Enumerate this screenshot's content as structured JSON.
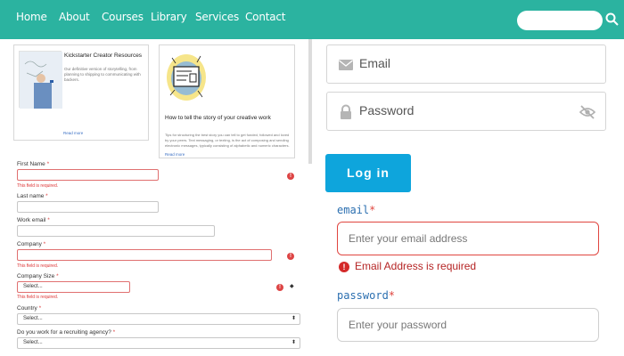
{
  "nav": {
    "items": [
      "Home",
      "About",
      "Courses",
      "Library",
      "Services",
      "Contact"
    ],
    "search_icon": "search-icon"
  },
  "cards": [
    {
      "title": "Kickstarter Creator Resources",
      "description": "Our definitive version of storytelling, from planning to shipping to communicating with backers.",
      "link": "Read more"
    },
    {
      "title": "How to tell the story of your creative work",
      "description": "Tips for structuring the best story you can tell to get funded, followed and loved by your peers. Text messaging, or texting, is the act of composing and sending electronic messages, typically consisting of alphabetic and numeric characters.",
      "link": "Read more"
    }
  ],
  "form": {
    "first_name_label": "First Name",
    "last_name_label": "Last name",
    "work_email_label": "Work email",
    "company_label": "Company",
    "company_size_label": "Company Size",
    "country_label": "Country",
    "recruiting_label": "Do you work for a recruiting agency?",
    "required_mark": "*",
    "required_error": "This field is required.",
    "select_placeholder": "Select..."
  },
  "login": {
    "email_placeholder": "Email",
    "password_placeholder": "Password",
    "button_label": "Log in"
  },
  "validation": {
    "email_label": "email",
    "password_label": "password",
    "required_mark": "*",
    "email_placeholder": "Enter your email address",
    "password_placeholder": "Enter your password",
    "email_error": "Email Address is required"
  },
  "colors": {
    "nav_bg": "#2bb3a0",
    "button_bg": "#0ea5dc",
    "error": "#d42a2a",
    "label_blue": "#2b6fb0"
  }
}
